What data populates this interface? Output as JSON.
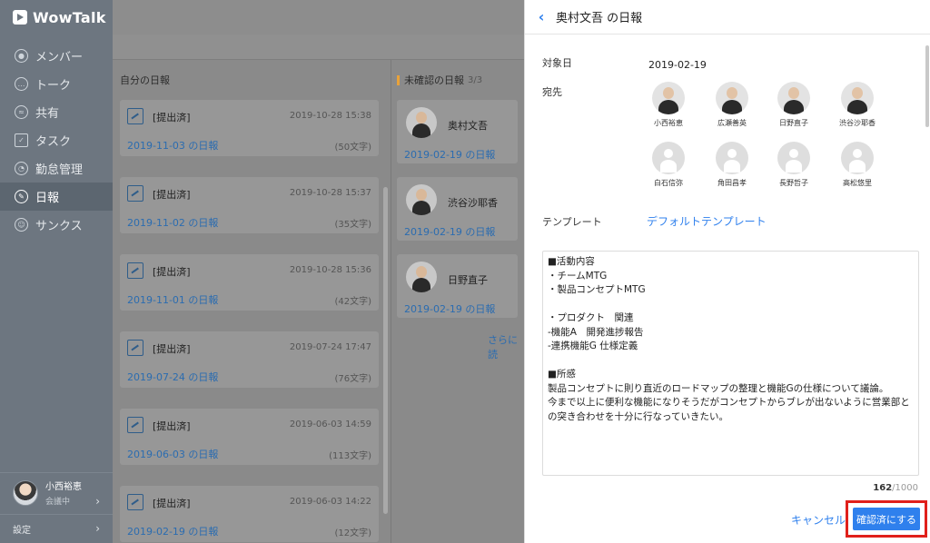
{
  "app": {
    "name": "WowTalk"
  },
  "sidebar": {
    "items": [
      {
        "label": "メンバー",
        "icon": "person-icon"
      },
      {
        "label": "トーク",
        "icon": "chat-icon"
      },
      {
        "label": "共有",
        "icon": "share-icon"
      },
      {
        "label": "タスク",
        "icon": "clipboard-icon"
      },
      {
        "label": "勤怠管理",
        "icon": "clock-icon"
      },
      {
        "label": "日報",
        "icon": "report-icon",
        "active": true
      },
      {
        "label": "サンクス",
        "icon": "smile-icon"
      }
    ],
    "user": {
      "name": "小西裕恵",
      "status": "会議中"
    },
    "settings_label": "設定"
  },
  "left_column": {
    "title": "自分の日報",
    "cards": [
      {
        "status": "[提出済]",
        "time": "2019-10-28 15:38",
        "title": "2019-11-03 の日報",
        "count": "(50文字)"
      },
      {
        "status": "[提出済]",
        "time": "2019-10-28 15:37",
        "title": "2019-11-02 の日報",
        "count": "(35文字)"
      },
      {
        "status": "[提出済]",
        "time": "2019-10-28 15:36",
        "title": "2019-11-01 の日報",
        "count": "(42文字)"
      },
      {
        "status": "[提出済]",
        "time": "2019-07-24 17:47",
        "title": "2019-07-24 の日報",
        "count": "(76文字)"
      },
      {
        "status": "[提出済]",
        "time": "2019-06-03 14:59",
        "title": "2019-06-03 の日報",
        "count": "(113文字)"
      },
      {
        "status": "[提出済]",
        "time": "2019-06-03 14:22",
        "title": "2019-02-19 の日報",
        "count": "(12文字)"
      }
    ]
  },
  "right_column": {
    "title": "未確認の日報",
    "count": "3/3",
    "cards": [
      {
        "name": "奥村文吾",
        "title": "2019-02-19 の日報"
      },
      {
        "name": "渋谷沙耶香",
        "title": "2019-02-19 の日報"
      },
      {
        "name": "日野直子",
        "title": "2019-02-19 の日報"
      }
    ],
    "more_label": "さらに読"
  },
  "panel": {
    "title": "奥村文吾 の日報",
    "date_label": "対象日",
    "date_value": "2019-02-19",
    "recipients_label": "宛先",
    "recipients": [
      {
        "name": "小西裕恵",
        "photo": true
      },
      {
        "name": "広瀬善英",
        "photo": true
      },
      {
        "name": "日野直子",
        "photo": true
      },
      {
        "name": "渋谷沙耶香",
        "photo": true
      },
      {
        "name": "白石信弥",
        "photo": false
      },
      {
        "name": "角田昌孝",
        "photo": false
      },
      {
        "name": "長野哲子",
        "photo": false
      },
      {
        "name": "高松悠里",
        "photo": false
      }
    ],
    "template_label": "テンプレート",
    "template_value": "デフォルトテンプレート",
    "body": "■活動内容\n・チームMTG\n・製品コンセプトMTG\n\n・プロダクト　関連\n-機能A　開発進捗報告\n-連携機能G 仕様定義\n\n■所感\n製品コンセプトに則り直近のロードマップの整理と機能Gの仕様について議論。\n今まで以上に便利な機能になりそうだがコンセプトからブレが出ないように営業部との突き合わせを十分に行なっていきたい。",
    "char_count": "162",
    "char_max": "/1000",
    "cancel_label": "キャンセル",
    "confirm_label": "確認済にする"
  },
  "colors": {
    "accent": "#2f80ed",
    "highlight": "#e0201b",
    "sidebar": "#6d7680"
  }
}
